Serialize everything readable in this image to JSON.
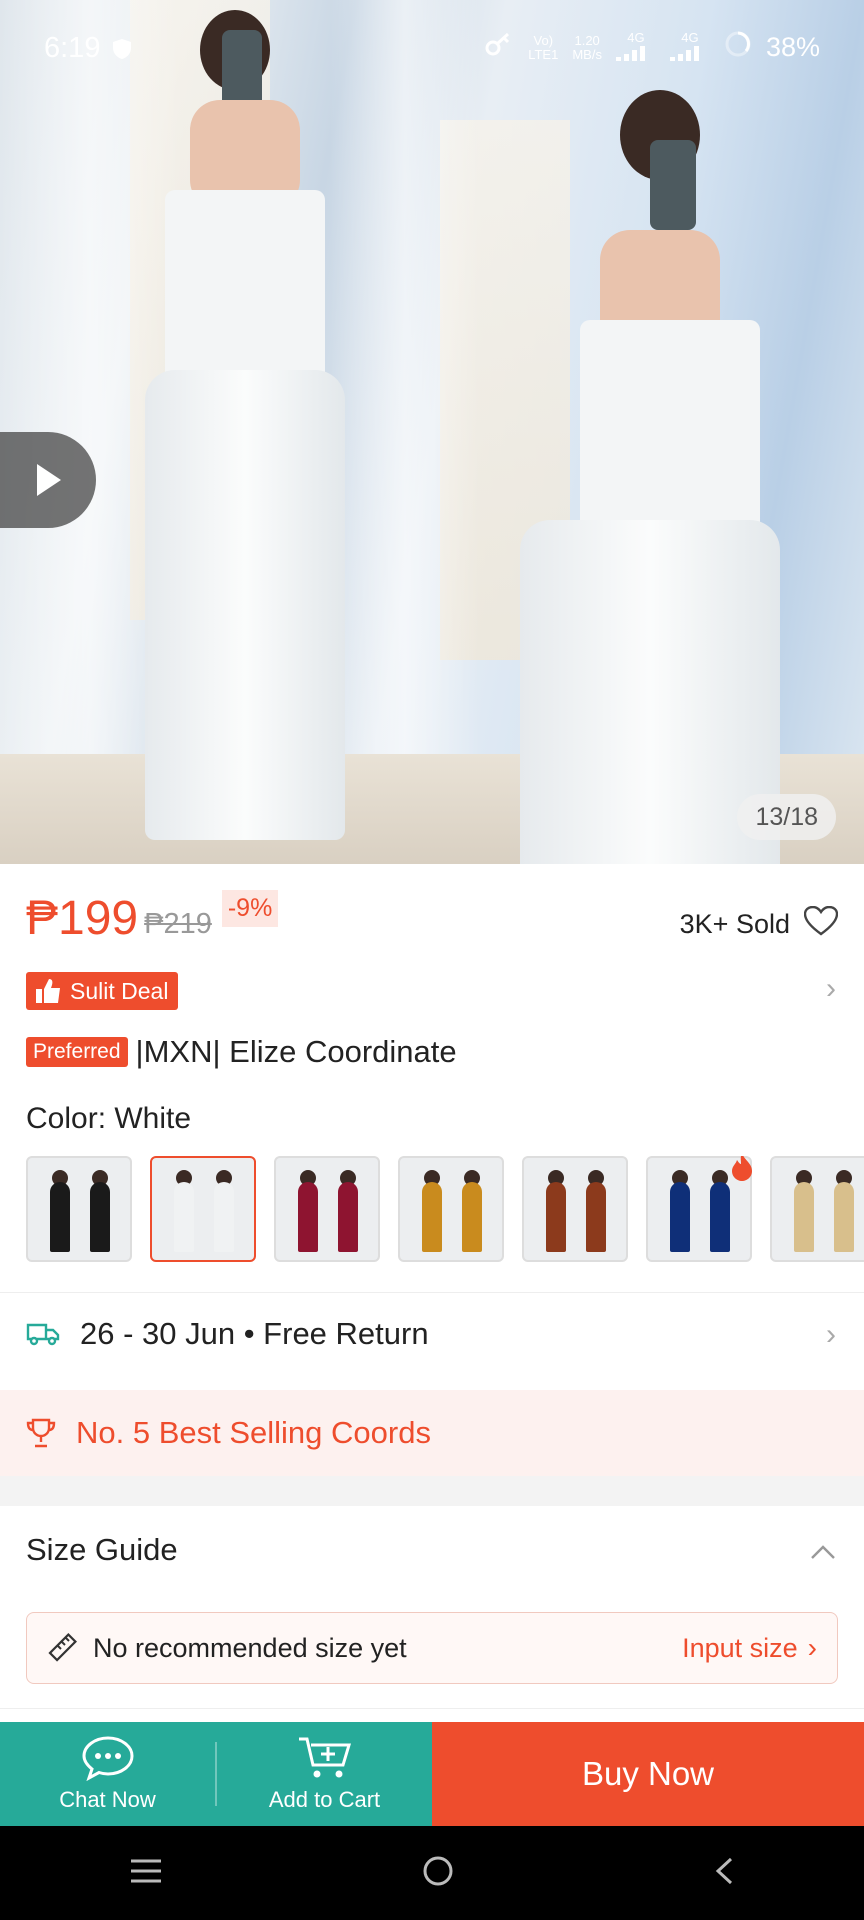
{
  "status_bar": {
    "time": "6:19",
    "network_speed_value": "1.20",
    "network_speed_unit": "MB/s",
    "volte": "Vo)",
    "lte": "LTE1",
    "signal1": "4G",
    "signal2": "4G",
    "battery": "38%"
  },
  "gallery": {
    "counter": "13/18"
  },
  "price": {
    "current": "₱199",
    "original": "₱219",
    "discount": "-9%",
    "sold": "3K+ Sold"
  },
  "deal": {
    "label": "Sulit Deal"
  },
  "product": {
    "badge": "Preferred",
    "title": "|MXN| Elize Coordinate"
  },
  "variation": {
    "label": "Color: White",
    "swatches": [
      {
        "color": "#1a1a1a"
      },
      {
        "color": "#f0f2f3"
      },
      {
        "color": "#8e1430"
      },
      {
        "color": "#c98b1e"
      },
      {
        "color": "#8c3a1c"
      },
      {
        "color": "#0f2f78"
      },
      {
        "color": "#d8bf8c"
      }
    ]
  },
  "shipping": {
    "text": "26 - 30 Jun • Free Return"
  },
  "ranking": {
    "text": "No. 5 Best Selling Coords"
  },
  "size_guide": {
    "title": "Size Guide",
    "recommendation": "No recommended size yet",
    "input_link": "Input size"
  },
  "actions": {
    "chat": "Chat Now",
    "cart": "Add to Cart",
    "buy": "Buy Now"
  },
  "colors": {
    "accent": "#ee4d2d",
    "secondary": "#26aa99"
  }
}
